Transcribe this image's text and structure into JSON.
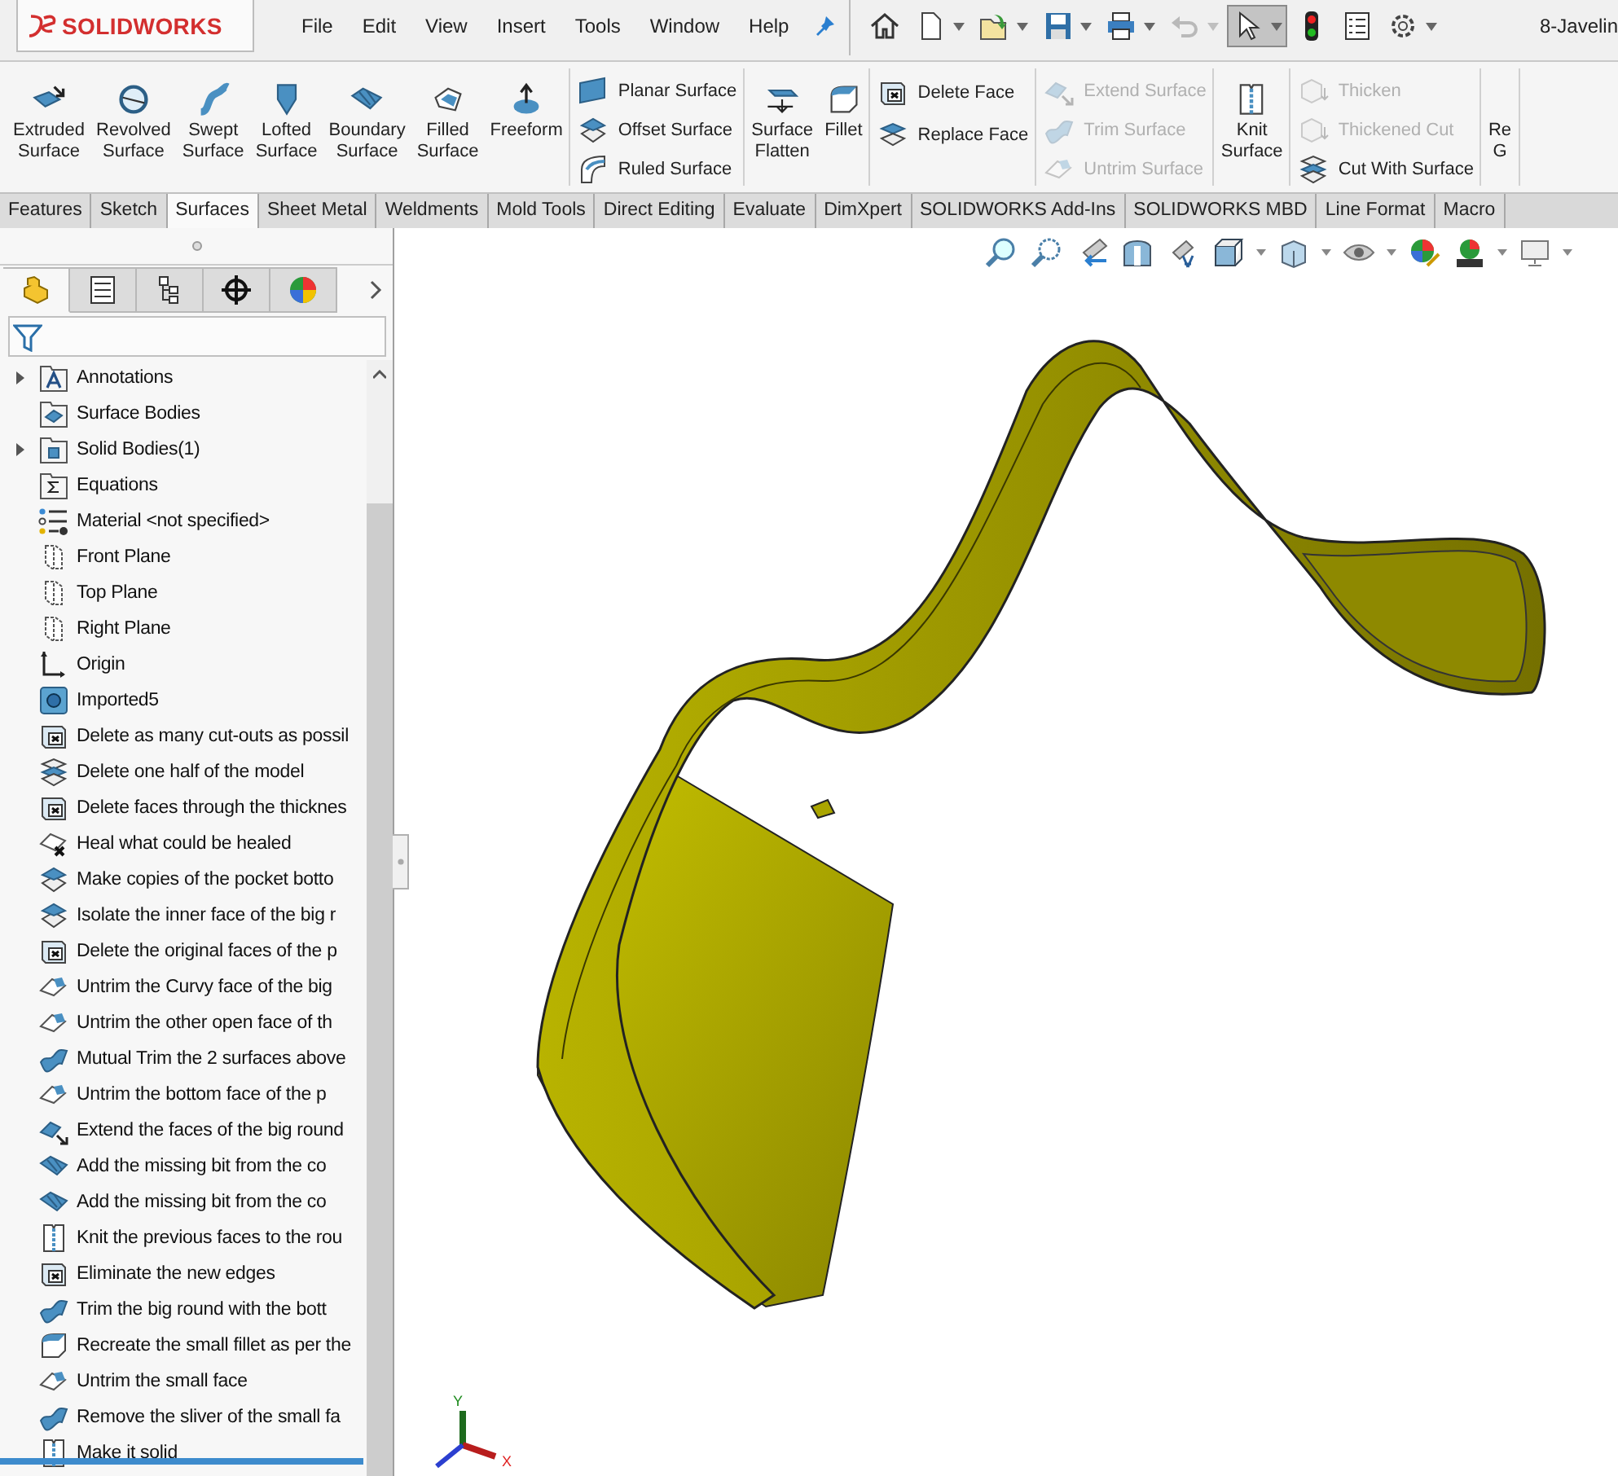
{
  "app": {
    "logo": "SOLIDWORKS",
    "document_title": "8-Javelin"
  },
  "menu": [
    "File",
    "Edit",
    "View",
    "Insert",
    "Tools",
    "Window",
    "Help"
  ],
  "quick_access": [
    {
      "kind": "home",
      "caret": false,
      "pressed": false,
      "disabled": false
    },
    {
      "kind": "new",
      "caret": true,
      "pressed": false,
      "disabled": false
    },
    {
      "kind": "open",
      "caret": true,
      "pressed": false,
      "disabled": false
    },
    {
      "kind": "save",
      "caret": true,
      "pressed": false,
      "disabled": false
    },
    {
      "kind": "print",
      "caret": true,
      "pressed": false,
      "disabled": false
    },
    {
      "kind": "undo",
      "caret": true,
      "pressed": false,
      "disabled": true
    },
    {
      "kind": "select",
      "caret": true,
      "pressed": true,
      "disabled": false
    },
    {
      "kind": "rebuild",
      "caret": false,
      "pressed": false,
      "disabled": false
    },
    {
      "kind": "file-properties",
      "caret": false,
      "pressed": false,
      "disabled": false
    },
    {
      "kind": "options",
      "caret": true,
      "pressed": false,
      "disabled": false
    }
  ],
  "ribbon": [
    {
      "kind": "large",
      "items": [
        {
          "kind": "extrude",
          "label": [
            "Extruded",
            "Surface"
          ],
          "disabled": false
        },
        {
          "kind": "revolve",
          "label": [
            "Revolved",
            "Surface"
          ],
          "disabled": false
        },
        {
          "kind": "sweep",
          "label": [
            "Swept",
            "Surface"
          ],
          "disabled": false
        },
        {
          "kind": "loft",
          "label": [
            "Lofted",
            "Surface"
          ],
          "disabled": false
        },
        {
          "kind": "boundary",
          "label": [
            "Boundary",
            "Surface"
          ],
          "disabled": false
        },
        {
          "kind": "fill",
          "label": [
            "Filled",
            "Surface"
          ],
          "disabled": false
        },
        {
          "kind": "freeform",
          "label": [
            "Freeform"
          ],
          "disabled": false
        }
      ]
    },
    {
      "kind": "stack",
      "items": [
        {
          "kind": "planar",
          "label": "Planar Surface",
          "disabled": false
        },
        {
          "kind": "offset",
          "label": "Offset Surface",
          "disabled": false
        },
        {
          "kind": "ruled",
          "label": "Ruled Surface",
          "disabled": false
        }
      ]
    },
    {
      "kind": "large",
      "items": [
        {
          "kind": "flatten",
          "label": [
            "Surface",
            "Flatten"
          ],
          "disabled": false
        },
        {
          "kind": "fillet",
          "label": [
            "Fillet"
          ],
          "disabled": false
        }
      ]
    },
    {
      "kind": "stack",
      "items": [
        {
          "kind": "delete-face",
          "label": "Delete Face",
          "disabled": false
        },
        {
          "kind": "replace-face",
          "label": "Replace Face",
          "disabled": false
        }
      ]
    },
    {
      "kind": "stack",
      "items": [
        {
          "kind": "extend",
          "label": "Extend Surface",
          "disabled": true
        },
        {
          "kind": "trim",
          "label": "Trim Surface",
          "disabled": true
        },
        {
          "kind": "untrim",
          "label": "Untrim Surface",
          "disabled": true
        }
      ]
    },
    {
      "kind": "large",
      "items": [
        {
          "kind": "knit",
          "label": [
            "Knit",
            "Surface"
          ],
          "disabled": false
        }
      ]
    },
    {
      "kind": "stack",
      "items": [
        {
          "kind": "thicken",
          "label": "Thicken",
          "disabled": true
        },
        {
          "kind": "thicken",
          "label": "Thickened Cut",
          "disabled": true
        },
        {
          "kind": "cut",
          "label": "Cut With Surface",
          "disabled": false
        }
      ]
    },
    {
      "kind": "large",
      "items": [
        {
          "kind": "none",
          "label": [
            "Re",
            "G"
          ],
          "disabled": false
        }
      ]
    }
  ],
  "tabs": [
    {
      "label": "Features",
      "selected": false
    },
    {
      "label": "Sketch",
      "selected": false
    },
    {
      "label": "Surfaces",
      "selected": true
    },
    {
      "label": "Sheet Metal",
      "selected": false
    },
    {
      "label": "Weldments",
      "selected": false
    },
    {
      "label": "Mold Tools",
      "selected": false
    },
    {
      "label": "Direct Editing",
      "selected": false
    },
    {
      "label": "Evaluate",
      "selected": false
    },
    {
      "label": "DimXpert",
      "selected": false
    },
    {
      "label": "SOLIDWORKS Add-Ins",
      "selected": false
    },
    {
      "label": "SOLIDWORKS MBD",
      "selected": false
    },
    {
      "label": "Line Format",
      "selected": false
    },
    {
      "label": "Macro",
      "selected": false
    }
  ],
  "panel_tabs": [
    {
      "kind": "feature-tree",
      "selected": true
    },
    {
      "kind": "property",
      "selected": false
    },
    {
      "kind": "config",
      "selected": false
    },
    {
      "kind": "dimxpert",
      "selected": false
    },
    {
      "kind": "display",
      "selected": false
    }
  ],
  "tree": [
    {
      "label": "Annotations",
      "kind": "annotations",
      "expandable": true
    },
    {
      "label": "Surface Bodies",
      "kind": "surface-folder",
      "expandable": false
    },
    {
      "label": "Solid Bodies(1)",
      "kind": "solid-folder",
      "expandable": true
    },
    {
      "label": "Equations",
      "kind": "equations",
      "expandable": false
    },
    {
      "label": "Material <not specified>",
      "kind": "material",
      "expandable": false
    },
    {
      "label": "Front Plane",
      "kind": "plane",
      "expandable": false
    },
    {
      "label": "Top Plane",
      "kind": "plane",
      "expandable": false
    },
    {
      "label": "Right Plane",
      "kind": "plane",
      "expandable": false
    },
    {
      "label": "Origin",
      "kind": "origin",
      "expandable": false
    },
    {
      "label": "Imported5",
      "kind": "imported",
      "expandable": false
    },
    {
      "label": "Delete as many cut-outs as possil",
      "kind": "delete-face",
      "expandable": false
    },
    {
      "label": "Delete one half of the model",
      "kind": "cut",
      "expandable": false
    },
    {
      "label": "Delete faces through the thicknes",
      "kind": "delete-face",
      "expandable": false
    },
    {
      "label": "Heal what could be healed",
      "kind": "heal",
      "expandable": false
    },
    {
      "label": "Make copies of the pocket botto",
      "kind": "offset",
      "expandable": false
    },
    {
      "label": "Isolate the inner face of the big r",
      "kind": "offset",
      "expandable": false
    },
    {
      "label": "Delete the original faces of the p",
      "kind": "delete-face",
      "expandable": false
    },
    {
      "label": "Untrim the Curvy face of the big",
      "kind": "untrim",
      "expandable": false
    },
    {
      "label": "Untrim the other open face of th",
      "kind": "untrim",
      "expandable": false
    },
    {
      "label": "Mutual Trim the 2 surfaces above",
      "kind": "trim",
      "expandable": false
    },
    {
      "label": "Untrim the bottom face of the p",
      "kind": "untrim",
      "expandable": false
    },
    {
      "label": "Extend the faces of the big round",
      "kind": "extend",
      "expandable": false
    },
    {
      "label": "Add the missing bit from the co",
      "kind": "boundary",
      "expandable": false
    },
    {
      "label": "Add the missing bit from the co",
      "kind": "boundary",
      "expandable": false
    },
    {
      "label": "Knit the previous faces to the rou",
      "kind": "knit",
      "expandable": false
    },
    {
      "label": "Eliminate the new edges",
      "kind": "delete-face",
      "expandable": false
    },
    {
      "label": "Trim the big round with the bott",
      "kind": "trim",
      "expandable": false
    },
    {
      "label": "Recreate the small fillet as per the",
      "kind": "fillet",
      "expandable": false
    },
    {
      "label": "Untrim the small face",
      "kind": "untrim",
      "expandable": false
    },
    {
      "label": "Remove the sliver of the small fa",
      "kind": "trim",
      "expandable": false
    },
    {
      "label": "Make it solid",
      "kind": "knit",
      "expandable": false
    }
  ],
  "triad": {
    "x": "X",
    "y": "Y"
  }
}
